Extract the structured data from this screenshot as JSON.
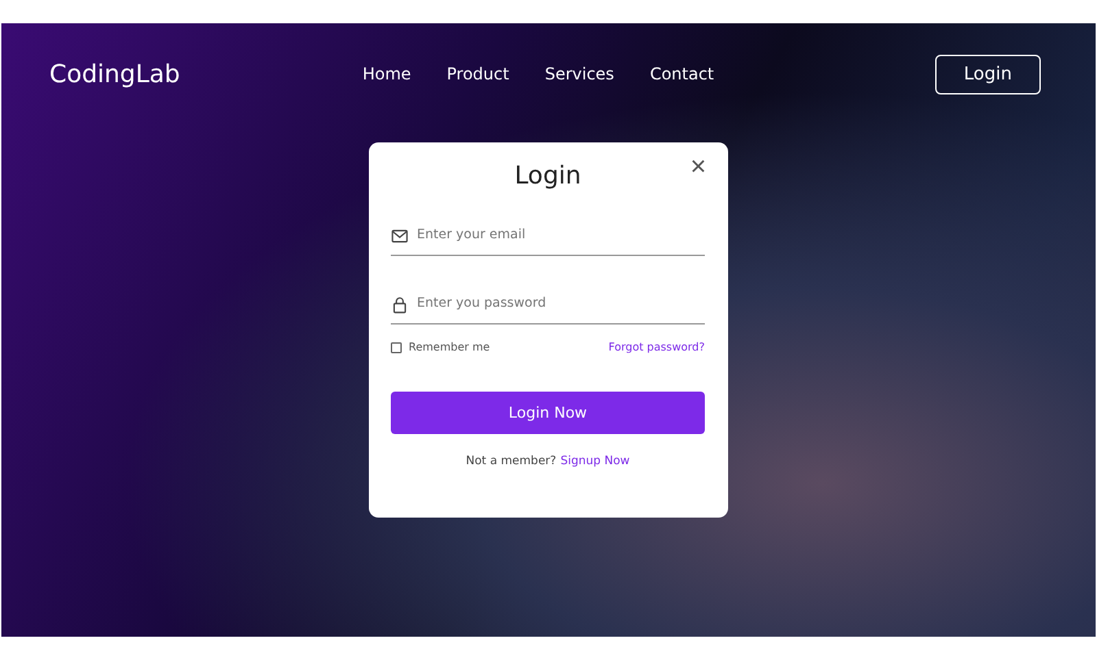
{
  "header": {
    "logo": "CodingLab",
    "nav": [
      "Home",
      "Product",
      "Services",
      "Contact"
    ],
    "login_button": "Login"
  },
  "modal": {
    "title": "Login",
    "close": "×",
    "fields": [
      {
        "kind": "email",
        "placeholder": "Enter your email"
      },
      {
        "kind": "password",
        "placeholder": "Enter you password"
      }
    ],
    "remember": {
      "label": "Remember me",
      "checked": false
    },
    "forgot": "Forgot password?",
    "submit": "Login Now",
    "signup_prompt": "Not a member?",
    "signup_link": "Signup Now"
  }
}
